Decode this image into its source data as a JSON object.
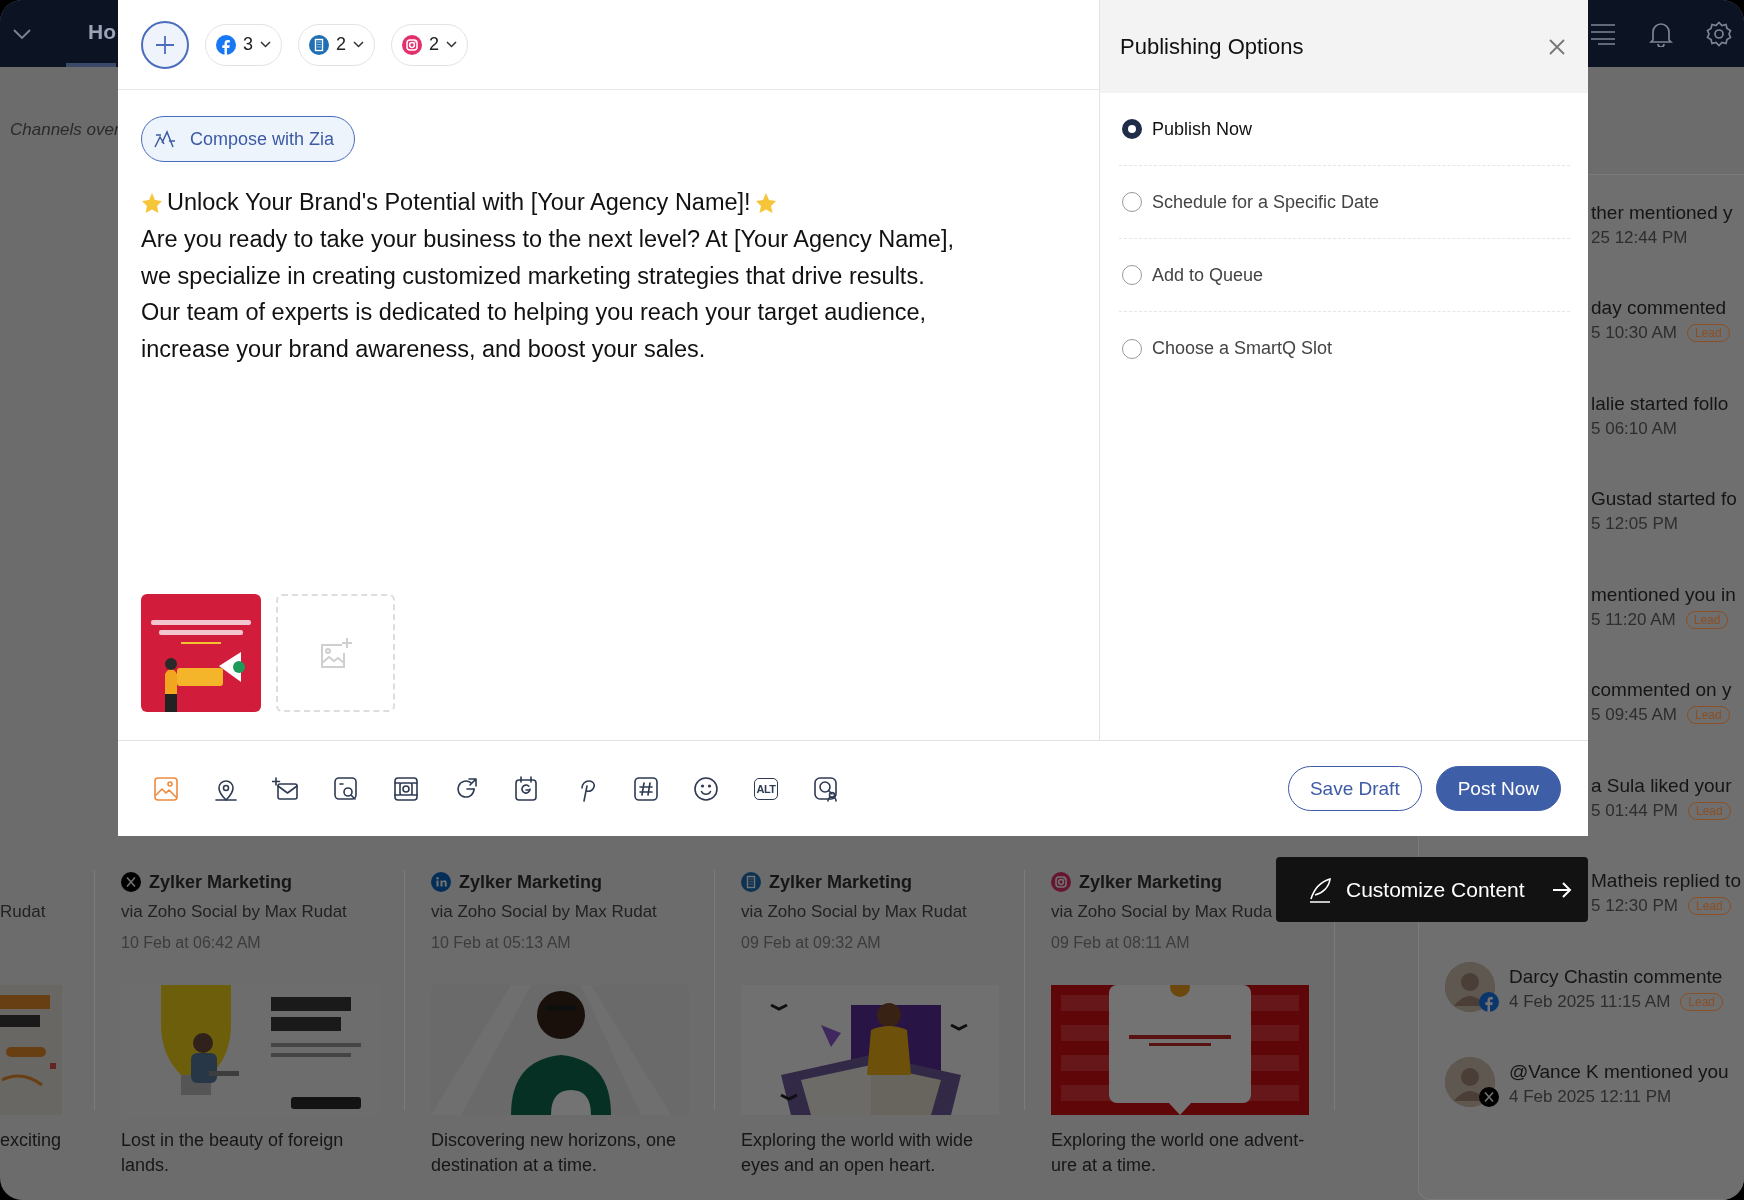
{
  "app_bar": {
    "tab": "Ho"
  },
  "channels_heading": "Channels over",
  "composer": {
    "channel_pills": [
      {
        "count": "3"
      },
      {
        "count": "2"
      },
      {
        "count": "2"
      }
    ],
    "compose_button": "Compose with Zia",
    "post_title": "Unlock Your Brand's Potential with [Your Agency Name]!",
    "post_body": "Are you ready to take your business to the next level? At [Your Agency Name],\nwe specialize in creating customized marketing strategies that drive results.\nOur team of experts is dedicated to helping you reach your target audience,\nincrease your brand awareness, and boost your sales.",
    "media": [
      {
        "kind": "picture"
      },
      {
        "kind": "add"
      }
    ],
    "toolbar": [
      {
        "selected": true
      },
      {
        "selected": false
      },
      {
        "selected": false
      },
      {
        "selected": false
      },
      {
        "selected": false
      },
      {
        "selected": false
      },
      {
        "selected": false
      },
      {
        "selected": false
      },
      {
        "selected": false
      },
      {
        "selected": false
      },
      {
        "text": "ALT",
        "selected": false
      },
      {
        "selected": false
      }
    ],
    "buttons": [
      {
        "kind": "secondary",
        "label": "Save Draft"
      },
      {
        "kind": "primary",
        "label": "Post Now"
      }
    ]
  },
  "publishing_options": {
    "title": "Publishing Options",
    "options": [
      {
        "label": "Publish Now",
        "selected": true
      },
      {
        "label": "Schedule for a Specific Date",
        "selected": false
      },
      {
        "label": "Add to Queue",
        "selected": false
      },
      {
        "label": "Choose a SmartQ Slot",
        "selected": false
      }
    ]
  },
  "posts": [
    {
      "kind": "cut",
      "via": "Rudat",
      "caption": "exciting"
    },
    {
      "kind": "full",
      "account": "Zylker Marketing",
      "via": "via Zoho Social by Max Rudat",
      "date": "10 Feb at 06:42 AM",
      "caption": "Lost in the beauty of foreign\nlands."
    },
    {
      "kind": "full",
      "account": "Zylker Marketing",
      "via": "via Zoho Social by Max Rudat",
      "date": "10 Feb at 05:13 AM",
      "caption": "Discovering new horizons, one\ndestination at a time."
    },
    {
      "kind": "full",
      "account": "Zylker Marketing",
      "via": "via Zoho Social by Max Rudat",
      "date": "09 Feb at 09:32 AM",
      "caption": "Exploring the world with wide\neyes and an open heart."
    },
    {
      "kind": "full",
      "account": "Zylker Marketing",
      "via": "via Zoho Social by Max Ruda",
      "date": "09 Feb at 08:11 AM",
      "caption": "Exploring the world one advent-\nure at a time."
    }
  ],
  "activity": [
    {
      "kind": "cut",
      "text": "ther mentioned y",
      "time": "25 12:44 PM"
    },
    {
      "kind": "cut",
      "text": "day commented",
      "time": "5 10:30 AM",
      "badge": "Lead"
    },
    {
      "kind": "cut",
      "text": "lalie started follo",
      "time": "5 06:10 AM"
    },
    {
      "kind": "cut",
      "text": "Gustad started fo",
      "time": "5 12:05 PM"
    },
    {
      "kind": "cut",
      "text": "mentioned you in",
      "time": "5 11:20 AM",
      "badge": "Lead"
    },
    {
      "kind": "cut",
      "text": "commented on y",
      "time": "5 09:45 AM",
      "badge": "Lead"
    },
    {
      "kind": "cut",
      "text": "a Sula liked your",
      "time": "5 01:44 PM",
      "badge": "Lead"
    },
    {
      "kind": "cut",
      "text": "Matheis replied to",
      "time": "5 12:30 PM",
      "badge": "Lead"
    },
    {
      "kind": "full",
      "text": "Darcy Chastin commente",
      "time": "4 Feb 2025 11:15 AM",
      "badge": "Lead"
    },
    {
      "kind": "full",
      "text": "@Vance K mentioned you",
      "time": "4 Feb 2025 12:11 PM"
    }
  ],
  "tooltip": {
    "label": "Customize Content"
  }
}
